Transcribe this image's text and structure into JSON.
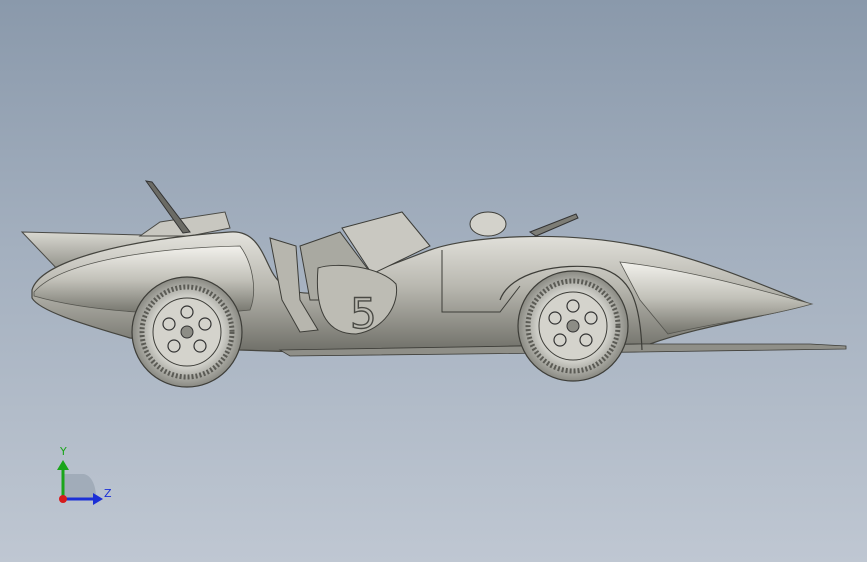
{
  "viewport": {
    "model_name": "race-car",
    "car_number": "5",
    "background_top": "#8a99ab",
    "background_bottom": "#bfc7d2"
  },
  "triad": {
    "y_label": "Y",
    "z_label": "Z",
    "y_color": "#1aa51a",
    "z_color": "#1b2fd6",
    "x_color": "#d61b1b"
  }
}
